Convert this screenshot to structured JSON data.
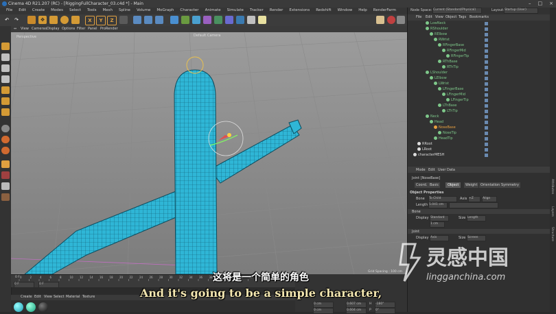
{
  "window": {
    "title": "Cinema 4D R21.207 (RC) - [RiggingFullCharacter_03.c4d *] - Main",
    "controls": [
      "–",
      "□",
      "×"
    ]
  },
  "menubar": [
    "File",
    "Edit",
    "Create",
    "Modes",
    "Select",
    "Tools",
    "Mesh",
    "Spline",
    "Volume",
    "MoGraph",
    "Character",
    "Animate",
    "Simulate",
    "Tracker",
    "Render",
    "Extensions",
    "Redshift",
    "Window",
    "Help",
    "RenderFarm"
  ],
  "toolbar": {
    "axis_x": "X",
    "axis_y": "Y",
    "axis_z": "Z"
  },
  "viewport": {
    "menu": [
      "View",
      "Cameras",
      "Display",
      "Options",
      "Filter",
      "Panel",
      "ProRender"
    ],
    "label": "Perspective",
    "camera": "Default Camera",
    "grid_spacing": "Grid Spacing : 100 cm"
  },
  "timeline": {
    "ticks": [
      "0",
      "2",
      "4",
      "6",
      "8",
      "10",
      "12",
      "14",
      "16",
      "18",
      "20",
      "22",
      "24",
      "26",
      "28",
      "30",
      "32",
      "34",
      "36",
      "38",
      "40",
      "42",
      "44",
      "46"
    ],
    "current_frame": "0 F",
    "start_field": "0 F",
    "end_field": "0 F",
    "frame_label": "0 F"
  },
  "material_panel": {
    "menu": [
      "Create",
      "Edit",
      "View",
      "Select",
      "Material",
      "Texture"
    ]
  },
  "coords": {
    "rows": [
      [
        "0 cm",
        "0.607 cm",
        "H",
        "-180°"
      ],
      [
        "0 cm",
        "0.604 cm",
        "P",
        "0°"
      ]
    ]
  },
  "object_manager": {
    "node_space_label": "Node Space:",
    "node_space_value": "Current (Standard/Physical)",
    "layout_label": "Layout:",
    "layout_value": "Startup (User)",
    "menu": [
      "File",
      "Edit",
      "View",
      "Object",
      "Tags",
      "Bookmarks"
    ],
    "tree": [
      {
        "name": "LowNeck",
        "depth": 3,
        "color": "#7ec88a"
      },
      {
        "name": "RShoulder",
        "depth": 3,
        "color": "#7ec88a"
      },
      {
        "name": "RElbow",
        "depth": 4,
        "color": "#7ec88a"
      },
      {
        "name": "RWrist",
        "depth": 5,
        "color": "#7ec88a"
      },
      {
        "name": "RFingerBase",
        "depth": 6,
        "color": "#7ec88a"
      },
      {
        "name": "RFingerMid",
        "depth": 7,
        "color": "#7ec88a"
      },
      {
        "name": "RFingerTip",
        "depth": 8,
        "color": "#7ec88a"
      },
      {
        "name": "RThBase",
        "depth": 6,
        "color": "#7ec88a"
      },
      {
        "name": "RThTip",
        "depth": 7,
        "color": "#7ec88a"
      },
      {
        "name": "LShoulder",
        "depth": 3,
        "color": "#7ec88a"
      },
      {
        "name": "LElbow",
        "depth": 4,
        "color": "#7ec88a"
      },
      {
        "name": "LWrist",
        "depth": 5,
        "color": "#7ec88a"
      },
      {
        "name": "LFingerBase",
        "depth": 6,
        "color": "#7ec88a"
      },
      {
        "name": "LFingerMid",
        "depth": 7,
        "color": "#7ec88a"
      },
      {
        "name": "LFingerTip",
        "depth": 8,
        "color": "#7ec88a"
      },
      {
        "name": "LThBase",
        "depth": 6,
        "color": "#7ec88a"
      },
      {
        "name": "LThTip",
        "depth": 7,
        "color": "#7ec88a"
      },
      {
        "name": "Neck",
        "depth": 3,
        "color": "#7ec88a"
      },
      {
        "name": "Head",
        "depth": 4,
        "color": "#7ec88a"
      },
      {
        "name": "NoseBase",
        "depth": 5,
        "color": "#e8a040"
      },
      {
        "name": "NoseTip",
        "depth": 6,
        "color": "#7ec88a"
      },
      {
        "name": "HeadTip",
        "depth": 5,
        "color": "#7ec88a"
      },
      {
        "name": "RRoot",
        "depth": 1,
        "color": "#dddddd"
      },
      {
        "name": "LRoot",
        "depth": 1,
        "color": "#dddddd"
      },
      {
        "name": "characterMESH",
        "depth": 0,
        "color": "#dddddd"
      }
    ]
  },
  "attributes": {
    "menu": [
      "Mode",
      "Edit",
      "User Data"
    ],
    "object_title": "Joint [NoseBase]",
    "tabs": [
      "Basic",
      "Coord.",
      "Object",
      "Weight",
      "Orientation",
      "Symmetry"
    ],
    "active_tab": "Object",
    "section": "Object Properties",
    "fields": [
      {
        "label": "Bone",
        "value": "To Child"
      },
      {
        "label": "Axis",
        "value": "+Z"
      },
      {
        "label": "Length",
        "value": "5.041 cm"
      }
    ],
    "align_label": "Align",
    "bone_section": "Bone",
    "display_label": "Display",
    "display_value": "Standard",
    "size_label": "Size",
    "size_value": "Length",
    "scale_value": "1 cm",
    "joint_section": "Joint",
    "joint_display_value": "Axis",
    "joint_size_value": "Screen",
    "side_tabs": [
      "Attributes",
      "Layers",
      "Structure"
    ]
  },
  "subtitles": {
    "zh": "这将是一个简单的角色",
    "en": "And it's going to be a simple character,"
  },
  "watermark": {
    "cn": "灵感中国",
    "url": "lingganchina.com"
  }
}
